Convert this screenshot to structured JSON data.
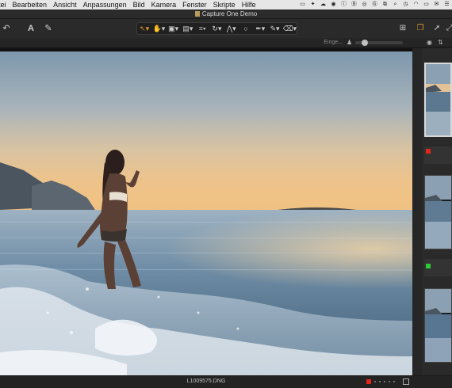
{
  "menubar": {
    "items": [
      "tei",
      "Bearbeiten",
      "Ansicht",
      "Anpassungen",
      "Bild",
      "Kamera",
      "Fenster",
      "Skripte",
      "Hilfe"
    ],
    "status_icons": [
      "display-icon",
      "dropbox-icon",
      "cloud-icon",
      "browser-icon",
      "info-icon",
      "b-icon",
      "circle-icon",
      "g-icon",
      "copy-icon",
      "search-icon",
      "clock-icon",
      "wifi-icon",
      "airplay-icon",
      "mail-icon",
      "list-icon"
    ]
  },
  "window": {
    "title": "Capture One Demo"
  },
  "toolbar": {
    "left_tools": [
      "undo-icon",
      "text-icon",
      "brush-icon"
    ],
    "center_tools": [
      "select-tool",
      "pan-tool",
      "crop-tool",
      "crop-tool-2",
      "rotate-tool",
      "keystone-tool",
      "spot-tool",
      "picker-tool",
      "brush-tool",
      "eraser-tool"
    ],
    "right_tools": [
      "layout-icon",
      "batch-icon",
      "export-icon",
      "overflow-icon"
    ]
  },
  "viewer_header": {
    "text": "Einge..."
  },
  "viewer": {
    "filename": "L1009575.DNG"
  },
  "filmstrip": {
    "flags": [
      "#e0271c",
      "#2bcc34"
    ]
  },
  "colors": {
    "accent": "#e39a2e",
    "red_flag": "#e0271c",
    "green_flag": "#2bcc34"
  }
}
